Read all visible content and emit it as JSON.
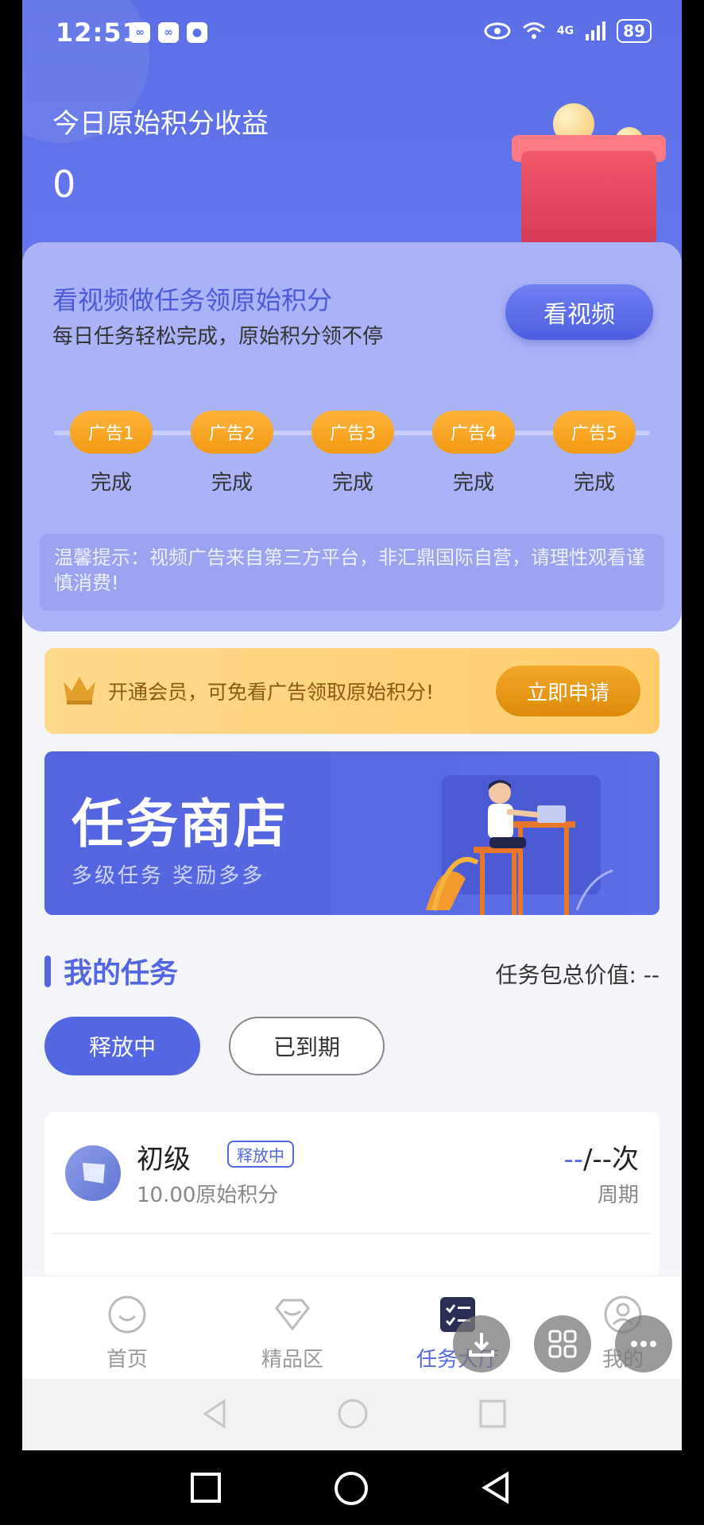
{
  "status_bar": {
    "time": "12:51",
    "battery": "89",
    "signal": "4G"
  },
  "hero": {
    "title": "今日原始积分收益",
    "value": "0"
  },
  "video_task": {
    "title": "看视频做任务领原始积分",
    "subtitle": "每日任务轻松完成，原始积分领不停",
    "button": "看视频",
    "ads": [
      {
        "label": "广告1",
        "status": "完成"
      },
      {
        "label": "广告2",
        "status": "完成"
      },
      {
        "label": "广告3",
        "status": "完成"
      },
      {
        "label": "广告4",
        "status": "完成"
      },
      {
        "label": "广告5",
        "status": "完成"
      }
    ],
    "tip": "温馨提示：视频广告来自第三方平台，非汇鼎国际自营，请理性观看谨慎消费!"
  },
  "vip": {
    "text": "开通会员，可免看广告领取原始积分!",
    "button": "立即申请"
  },
  "shop": {
    "title": "任务商店",
    "subtitle": "多级任务 奖励多多"
  },
  "my_tasks": {
    "title": "我的任务",
    "total_label": "任务包总价值: --",
    "tabs": {
      "active": "释放中",
      "expired": "已到期"
    },
    "items": [
      {
        "name": "初级",
        "badge": "释放中",
        "points": "10.00原始积分",
        "count_prefix": "--",
        "count_suffix": "/--次",
        "period": "周期"
      }
    ]
  },
  "nav": {
    "items": [
      {
        "label": "首页"
      },
      {
        "label": "精品区"
      },
      {
        "label": "任务大厅"
      },
      {
        "label": "我的"
      }
    ]
  },
  "colors": {
    "primary": "#5467e2",
    "accent": "#f39a14",
    "vip_bg": "#ffd98c"
  }
}
